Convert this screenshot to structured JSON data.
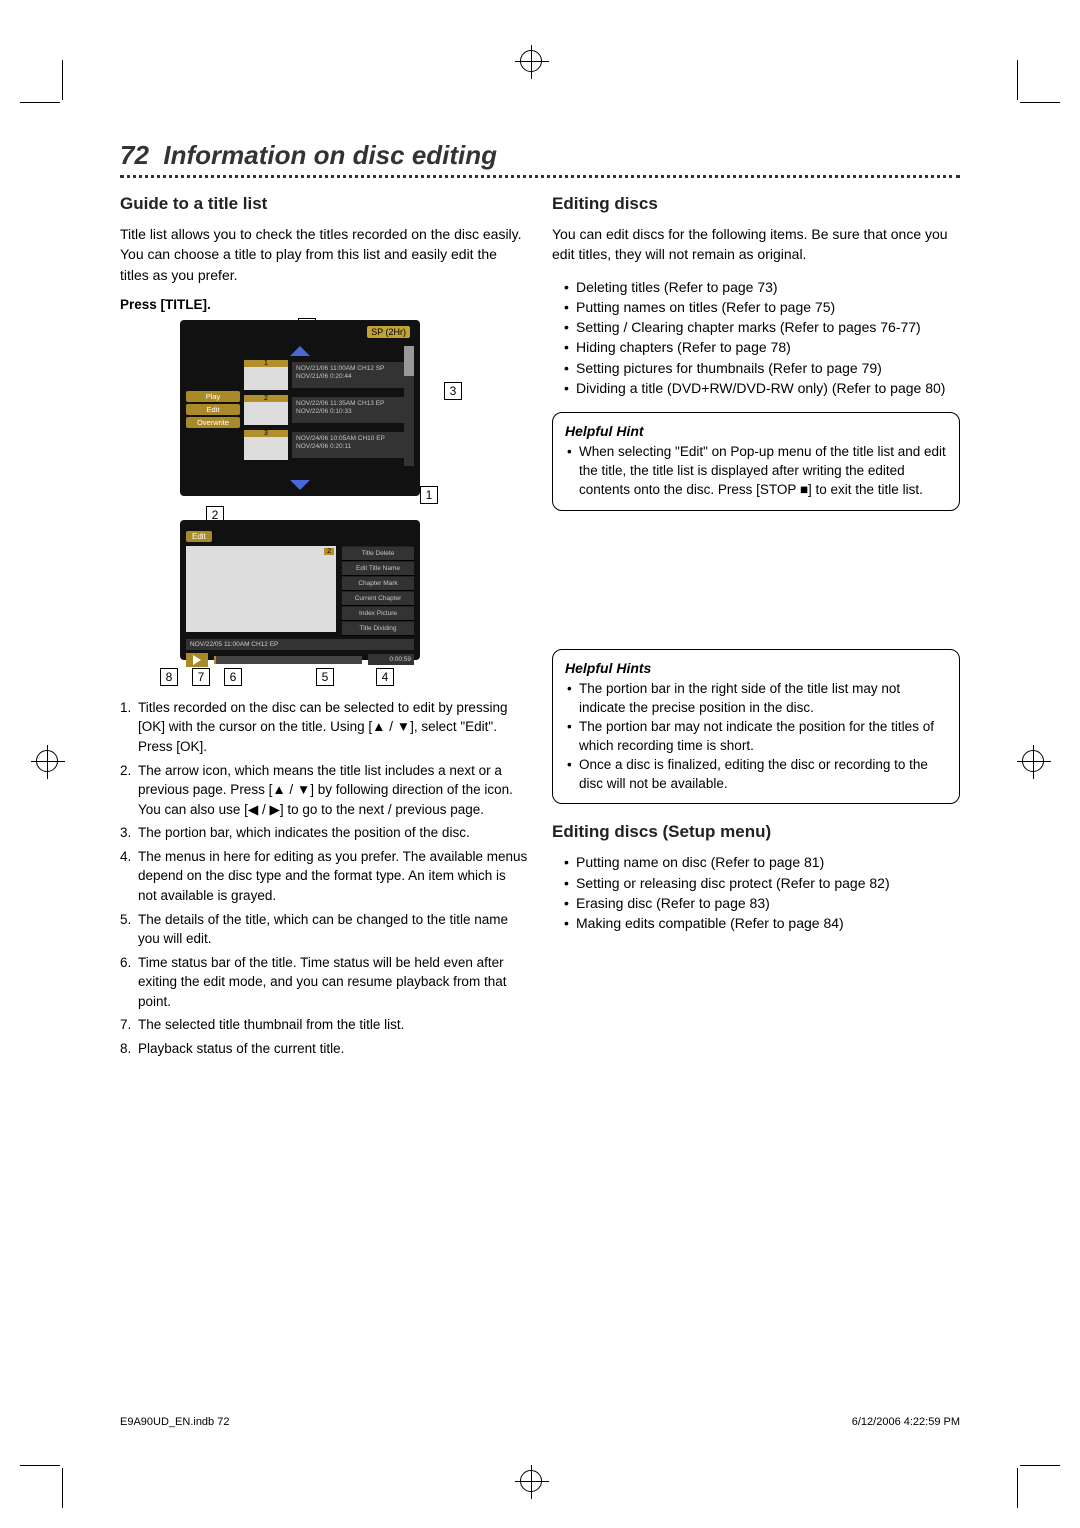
{
  "page": {
    "number": "72",
    "title": "Information on disc editing"
  },
  "left": {
    "heading": "Guide to a title list",
    "intro": "Title list allows you to check the titles recorded on the disc easily. You can choose a title to play from this list and easily edit the titles as you prefer.",
    "press": "Press [TITLE].",
    "osd": {
      "mode": "SP (2Hr)",
      "actions": {
        "play": "Play",
        "edit": "Edit",
        "overwrite": "Overwrite"
      },
      "rows": [
        {
          "num": "1",
          "line1": "NOV/21/06  11:00AM CH12  SP",
          "line2": "NOV/21/06  0:20:44"
        },
        {
          "num": "2",
          "line1": "NOV/22/06  11:35AM CH13  EP",
          "line2": "NOV/22/06  0:10:33"
        },
        {
          "num": "3",
          "line1": "NOV/24/06  10:05AM CH10  EP",
          "line2": "NOV/24/06  0:20:11"
        }
      ]
    },
    "edit": {
      "tag": "Edit",
      "chip": "2",
      "menu": [
        "Title Delete",
        "Edit Title Name",
        "Chapter Mark",
        "Current Chapter",
        "Index Picture",
        "Title Dividing"
      ],
      "meta": "NOV/22/05 11:00AM CH12 EP",
      "time": "0:00:59"
    },
    "callouts": {
      "c1": "1",
      "c2": "2",
      "c3": "3",
      "bottom": [
        "8",
        "7",
        "6",
        "5",
        "4"
      ]
    },
    "list": [
      "Titles recorded on the disc can be selected to edit by pressing [OK] with the cursor on the title. Using [▲ / ▼], select \"Edit\". Press [OK].",
      "The arrow icon, which means the title list includes a next or a previous page. Press [▲ / ▼] by following direction of the icon. You can also use [◀ / ▶] to go to the next / previous page.",
      "The portion bar, which indicates the position of the disc.",
      "The menus in here for editing as you prefer. The available menus depend on the disc type and the format type. An item which is not available is grayed.",
      "The details of the title, which can be changed to the title name you will edit.",
      "Time status bar of the title. Time status will be held even after exiting the edit mode, and you can resume playback from that point.",
      "The selected title thumbnail from the title list.",
      "Playback status of the current title."
    ]
  },
  "right": {
    "heading1": "Editing discs",
    "intro1": "You can edit discs for the following items. Be sure that once you edit titles, they will not remain as original.",
    "bullets1": [
      "Deleting titles (Refer to page 73)",
      "Putting names on titles (Refer to page 75)",
      "Setting / Clearing chapter marks (Refer to pages 76-77)",
      "Hiding chapters (Refer to page 78)",
      "Setting pictures for thumbnails (Refer to page 79)",
      "Dividing a title (DVD+RW/DVD-RW only) (Refer to page 80)"
    ],
    "hint1_head": "Helpful Hint",
    "hint1": "When selecting \"Edit\" on Pop-up menu of the title list and edit the title, the title list is displayed after writing the edited contents onto the disc. Press [STOP ■] to exit the title list.",
    "hint2_head": "Helpful Hints",
    "hint2": [
      "The portion bar in the right side of the title list may not indicate the precise position in the disc.",
      "The portion bar may not indicate the position for the titles of which recording time is short.",
      "Once a disc is finalized, editing the disc or recording to the disc will not be available."
    ],
    "heading2": "Editing discs (Setup menu)",
    "bullets2": [
      "Putting name on disc (Refer to page 81)",
      "Setting or releasing disc protect (Refer to page 82)",
      "Erasing disc (Refer to page 83)",
      "Making edits compatible (Refer to page 84)"
    ]
  },
  "footer": {
    "left": "E9A90UD_EN.indb   72",
    "right": "6/12/2006   4:22:59 PM"
  }
}
